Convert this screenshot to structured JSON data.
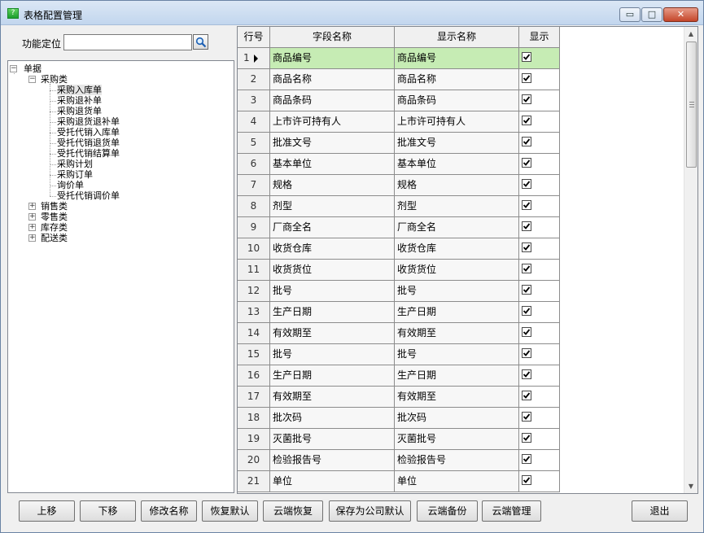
{
  "window": {
    "title": "表格配置管理",
    "app_icon_glyph": "?",
    "controls": {
      "minimize": "▭",
      "maximize": "□",
      "close": "✕"
    }
  },
  "search": {
    "label": "功能定位",
    "value": "",
    "placeholder": ""
  },
  "tree": {
    "root": {
      "label": "单据",
      "expander": "−"
    },
    "groups": [
      {
        "label": "采购类",
        "expander": "−",
        "children": [
          "采购入库单",
          "采购退补单",
          "采购退货单",
          "采购退货退补单",
          "受托代销入库单",
          "受托代销退货单",
          "受托代销结算单",
          "采购计划",
          "采购订单",
          "询价单",
          "受托代销调价单"
        ]
      },
      {
        "label": "销售类",
        "expander": "+"
      },
      {
        "label": "零售类",
        "expander": "+"
      },
      {
        "label": "库存类",
        "expander": "+"
      },
      {
        "label": "配送类",
        "expander": "+"
      }
    ],
    "selected": "采购入库单"
  },
  "grid": {
    "columns": [
      "行号",
      "字段名称",
      "显示名称",
      "显示"
    ],
    "rows": [
      {
        "no": "1",
        "field": "商品编号",
        "display": "商品编号",
        "show": true
      },
      {
        "no": "2",
        "field": "商品名称",
        "display": "商品名称",
        "show": true
      },
      {
        "no": "3",
        "field": "商品条码",
        "display": "商品条码",
        "show": true
      },
      {
        "no": "4",
        "field": "上市许可持有人",
        "display": "上市许可持有人",
        "show": true
      },
      {
        "no": "5",
        "field": "批准文号",
        "display": "批准文号",
        "show": true
      },
      {
        "no": "6",
        "field": "基本单位",
        "display": "基本单位",
        "show": true
      },
      {
        "no": "7",
        "field": "规格",
        "display": "规格",
        "show": true
      },
      {
        "no": "8",
        "field": "剂型",
        "display": "剂型",
        "show": true
      },
      {
        "no": "9",
        "field": "厂商全名",
        "display": "厂商全名",
        "show": true
      },
      {
        "no": "10",
        "field": "收货仓库",
        "display": "收货仓库",
        "show": true
      },
      {
        "no": "11",
        "field": "收货货位",
        "display": "收货货位",
        "show": true
      },
      {
        "no": "12",
        "field": "批号",
        "display": "批号",
        "show": true
      },
      {
        "no": "13",
        "field": "生产日期",
        "display": "生产日期",
        "show": true
      },
      {
        "no": "14",
        "field": "有效期至",
        "display": "有效期至",
        "show": true
      },
      {
        "no": "15",
        "field": "批号",
        "display": "批号",
        "show": true
      },
      {
        "no": "16",
        "field": "生产日期",
        "display": "生产日期",
        "show": true
      },
      {
        "no": "17",
        "field": "有效期至",
        "display": "有效期至",
        "show": true
      },
      {
        "no": "18",
        "field": "批次码",
        "display": "批次码",
        "show": true
      },
      {
        "no": "19",
        "field": "灭菌批号",
        "display": "灭菌批号",
        "show": true
      },
      {
        "no": "20",
        "field": "检验报告号",
        "display": "检验报告号",
        "show": true
      },
      {
        "no": "21",
        "field": "单位",
        "display": "单位",
        "show": true
      }
    ],
    "active_row": "1",
    "active_row_color": "#c6ecb4"
  },
  "scrollbar": {
    "up": "▲",
    "down": "▼"
  },
  "toolbar": {
    "buttons": [
      {
        "key": "move-up",
        "label": "上移"
      },
      {
        "key": "move-down",
        "label": "下移"
      },
      {
        "key": "rename",
        "label": "修改名称"
      },
      {
        "key": "restore-default",
        "label": "恢复默认"
      },
      {
        "key": "cloud-restore",
        "label": "云端恢复"
      },
      {
        "key": "save-company-default",
        "label": "保存为公司默认"
      },
      {
        "key": "cloud-backup",
        "label": "云端备份"
      },
      {
        "key": "cloud-manage",
        "label": "云端管理"
      },
      {
        "key": "exit",
        "label": "退出"
      }
    ]
  },
  "icons": {
    "search": "search-icon",
    "check": "check-icon",
    "row-pointer": "triangle-right-icon"
  }
}
